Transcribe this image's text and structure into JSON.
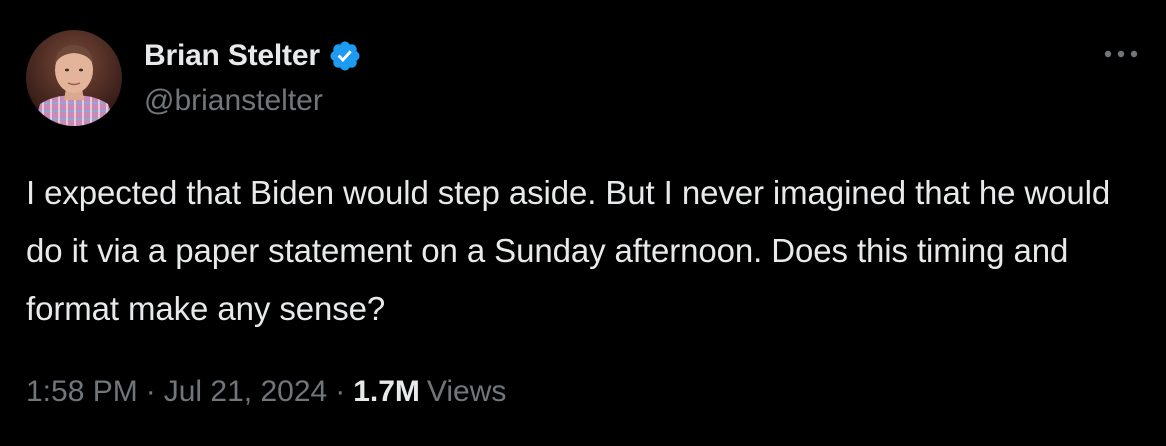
{
  "tweet": {
    "author": {
      "display_name": "Brian Stelter",
      "handle": "@brianstelter",
      "verified": true,
      "verified_color": "#1d9bf0"
    },
    "text": "I expected that Biden would step aside. But I never imagined that he would do it via a paper statement on a Sunday afternoon. Does this timing and format make any sense?",
    "time": "1:58 PM",
    "date": "Jul 21, 2024",
    "separator": "·",
    "views_count": "1.7M",
    "views_label": "Views",
    "more_icon": "more-horizontal-icon"
  },
  "colors": {
    "background": "#000000",
    "primary_text": "#e7e9ea",
    "secondary_text": "#71767b",
    "accent": "#1d9bf0"
  }
}
